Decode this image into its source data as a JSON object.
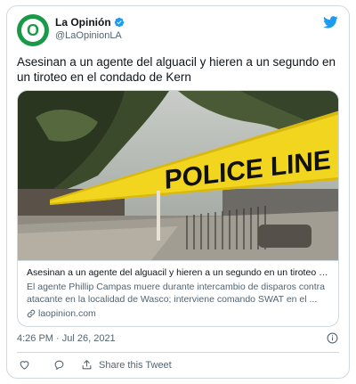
{
  "account": {
    "display_name": "La Opinión",
    "handle": "@LaOpinionLA",
    "avatar_letter": "O",
    "avatar_color": "#1a9a48",
    "verified": true
  },
  "tweet": {
    "text": "Asesinan a un agente del alguacil y hieren a un segundo en un tiroteo en el condado de Kern",
    "timestamp": "4:26 PM · Jul 26, 2021"
  },
  "link_card": {
    "image_text": "POLICE LINE DO",
    "title": "Asesinan a un agente del alguacil y hieren a un segundo en un tiroteo en el condado de Kern",
    "description": "El agente Phillip Campas muere durante intercambio de disparos contra atacante en la localidad de Wasco; interviene comando SWAT en el ...",
    "domain": "laopinion.com"
  },
  "actions": {
    "share_label": "Share this Tweet"
  },
  "colors": {
    "twitter_blue": "#1d9bf0",
    "text_secondary": "#536471",
    "border": "#cfd9de",
    "tape_yellow": "#f2d51e"
  },
  "icons": [
    "verified-badge-icon",
    "twitter-bird-icon",
    "link-icon",
    "info-icon",
    "heart-icon",
    "reply-bubble-icon",
    "share-icon"
  ]
}
